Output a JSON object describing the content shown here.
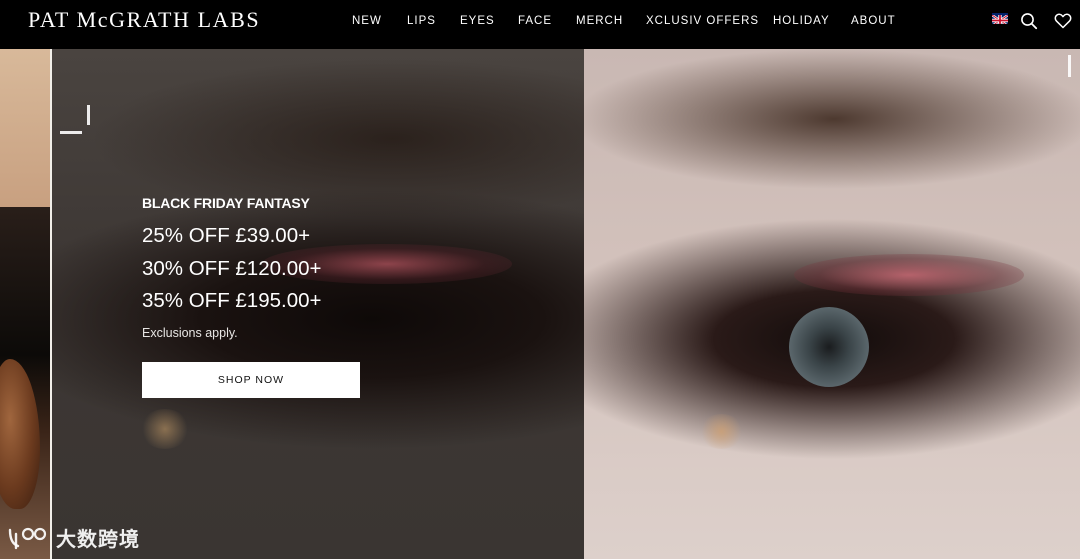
{
  "header": {
    "logo": "PAT McGRATH LABS",
    "nav": [
      {
        "label": "NEW"
      },
      {
        "label": "LIPS"
      },
      {
        "label": "EYES"
      },
      {
        "label": "FACE"
      },
      {
        "label": "MERCH"
      },
      {
        "label": "XCLUSIV OFFERS"
      },
      {
        "label": "HOLIDAY"
      },
      {
        "label": "ABOUT"
      }
    ],
    "icons": [
      "uk-flag-icon",
      "search-icon",
      "heart-icon"
    ]
  },
  "hero": {
    "title": "BLACK FRIDAY FANTASY",
    "offers": [
      "25% OFF £39.00+",
      "30% OFF £120.00+",
      "35% OFF £195.00+"
    ],
    "note": "Exclusions apply.",
    "cta_label": "SHOP NOW"
  },
  "watermark": {
    "text": "大数跨境"
  },
  "colors": {
    "header_bg": "#000000",
    "text_light": "#ffffff",
    "button_bg": "#ffffff",
    "button_text": "#111111"
  }
}
